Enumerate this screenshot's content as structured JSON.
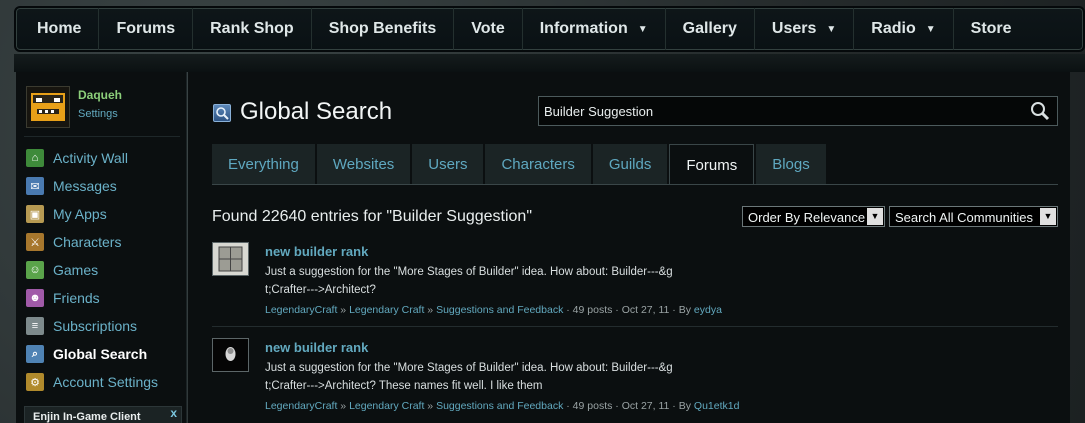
{
  "nav": {
    "items": [
      {
        "label": "Home",
        "dropdown": false
      },
      {
        "label": "Forums",
        "dropdown": false
      },
      {
        "label": "Rank Shop",
        "dropdown": false
      },
      {
        "label": "Shop Benefits",
        "dropdown": false
      },
      {
        "label": "Vote",
        "dropdown": false
      },
      {
        "label": "Information",
        "dropdown": true
      },
      {
        "label": "Gallery",
        "dropdown": false
      },
      {
        "label": "Users",
        "dropdown": true
      },
      {
        "label": "Radio",
        "dropdown": true
      },
      {
        "label": "Store",
        "dropdown": false
      }
    ],
    "dropdown_glyph": "▼"
  },
  "user": {
    "name": "Daqueh",
    "settings_label": "Settings"
  },
  "sidebar": {
    "items": [
      {
        "label": "Activity Wall",
        "icon": "home-icon",
        "color": "#3e8a3a",
        "glyph": "⌂"
      },
      {
        "label": "Messages",
        "icon": "envelope-icon",
        "color": "#4a7ab0",
        "glyph": "✉"
      },
      {
        "label": "My Apps",
        "icon": "apps-icon",
        "color": "#b79a52",
        "glyph": "▣"
      },
      {
        "label": "Characters",
        "icon": "sword-icon",
        "color": "#a7772d",
        "glyph": "⚔"
      },
      {
        "label": "Games",
        "icon": "gamepad-icon",
        "color": "#5aa34a",
        "glyph": "☺"
      },
      {
        "label": "Friends",
        "icon": "friends-icon",
        "color": "#a05aa8",
        "glyph": "☻"
      },
      {
        "label": "Subscriptions",
        "icon": "subscriptions-icon",
        "color": "#7d8a8c",
        "glyph": "≡"
      },
      {
        "label": "Global Search",
        "icon": "search-icon",
        "color": "#4f83b4",
        "glyph": "⌕"
      },
      {
        "label": "Account Settings",
        "icon": "gear-icon",
        "color": "#b08a2c",
        "glyph": "⚙"
      }
    ],
    "active_index": 7,
    "client_label": "Enjin In-Game Client",
    "client_close": "x"
  },
  "main": {
    "title": "Global Search",
    "search": {
      "value": "Builder Suggestion",
      "placeholder": ""
    },
    "tabs": [
      "Everything",
      "Websites",
      "Users",
      "Characters",
      "Guilds",
      "Forums",
      "Blogs"
    ],
    "active_tab": "Forums",
    "found_text": "Found 22640 entries for \"Builder Suggestion\"",
    "order_select": {
      "value": "Order By Relevance"
    },
    "scope_select": {
      "value": "Search All Communities"
    },
    "results": [
      {
        "title": "new builder rank",
        "snippet": "Just a suggestion for the \"More Stages of Builder\" idea. How about: Builder---&g t;Crafter--->Architect?",
        "community": "LegendaryCraft",
        "site": "Legendary Craft",
        "forum": "Suggestions and Feedback",
        "posts": "49 posts",
        "date": "Oct 27, 11",
        "by_label": "By",
        "author": "eydya"
      },
      {
        "title": "new builder rank",
        "snippet": "Just a suggestion for the \"More Stages of Builder\" idea. How about: Builder---&g t;Crafter--->Architect? These names fit well. I like them",
        "community": "LegendaryCraft",
        "site": "Legendary Craft",
        "forum": "Suggestions and Feedback",
        "posts": "49 posts",
        "date": "Oct 27, 11",
        "by_label": "By",
        "author": "Qu1etk1d"
      }
    ]
  }
}
